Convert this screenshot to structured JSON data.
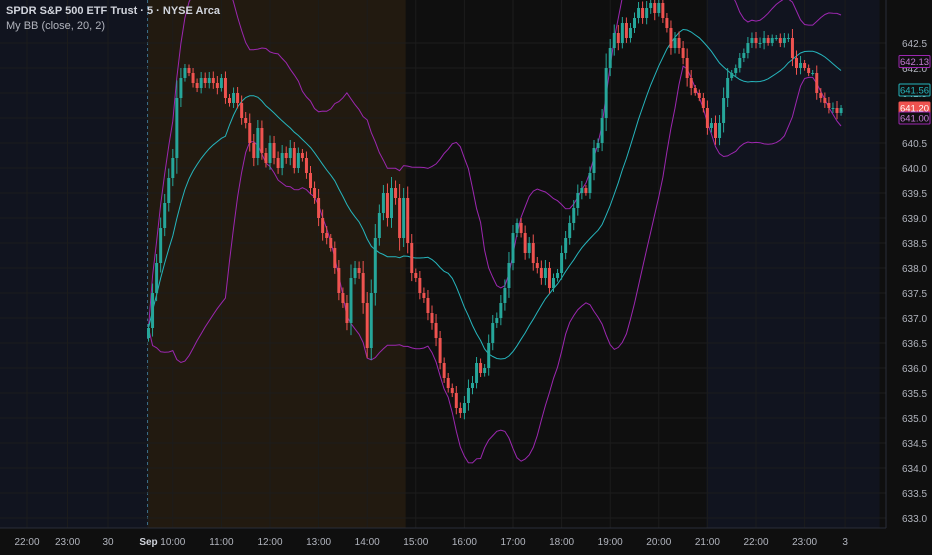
{
  "legend": {
    "symbol_title": "SPDR S&P 500 ETF Trust · 5 · NYSE Arca",
    "indicator": "My BB (close, 20, 2)"
  },
  "colors": {
    "background": "#0f0f0f",
    "up": "#26a69a",
    "down": "#ef5350",
    "basis": "#26b5bd",
    "bands": "#9c27b0",
    "premarket_bg": "#221a10",
    "afterhours_bg": "#11141f",
    "grid": "#1c1c1c",
    "axis_text": "#b2b5be"
  },
  "chart_data": {
    "type": "candlestick",
    "y_ticks": [
      "642.5",
      "642.0",
      "641.5",
      "641.0",
      "640.5",
      "640.0",
      "639.5",
      "639.0",
      "638.5",
      "638.0",
      "637.5",
      "637.0",
      "636.5",
      "636.0",
      "635.5",
      "635.0",
      "634.5",
      "634.0",
      "633.5",
      "633.0"
    ],
    "ylim": [
      632.8,
      643.2
    ],
    "x_ticks": [
      {
        "label": "22:00",
        "bar": -30
      },
      {
        "label": "23:00",
        "bar": -20
      },
      {
        "label": "30",
        "bar": -10
      },
      {
        "label": "Sep",
        "bar": 0,
        "bold": true
      },
      {
        "label": "10:00",
        "bar": 6
      },
      {
        "label": "11:00",
        "bar": 18
      },
      {
        "label": "12:00",
        "bar": 30
      },
      {
        "label": "13:00",
        "bar": 42
      },
      {
        "label": "14:00",
        "bar": 54
      },
      {
        "label": "15:00",
        "bar": 66
      },
      {
        "label": "16:00",
        "bar": 78
      },
      {
        "label": "17:00",
        "bar": 90
      },
      {
        "label": "18:00",
        "bar": 102
      },
      {
        "label": "19:00",
        "bar": 114
      },
      {
        "label": "20:00",
        "bar": 126
      },
      {
        "label": "21:00",
        "bar": 138
      },
      {
        "label": "22:00",
        "bar": 150
      },
      {
        "label": "23:00",
        "bar": 162
      },
      {
        "label": "3",
        "bar": 172
      }
    ],
    "sessions": [
      {
        "name": "premarket",
        "from": 0,
        "to": 63
      },
      {
        "name": "afterhours",
        "from": 138,
        "to": 180
      }
    ],
    "closes": [
      636.8,
      637.5,
      638.1,
      638.8,
      639.3,
      639.8,
      640.2,
      641.4,
      641.8,
      642.0,
      641.9,
      641.7,
      641.6,
      641.8,
      641.7,
      641.8,
      641.7,
      641.6,
      641.8,
      641.4,
      641.3,
      641.5,
      641.3,
      641.0,
      640.9,
      640.5,
      640.2,
      640.8,
      640.3,
      640.1,
      640.5,
      640.2,
      640.0,
      640.3,
      640.2,
      640.4,
      640.0,
      640.3,
      640.2,
      639.9,
      639.6,
      639.4,
      639.0,
      638.7,
      638.6,
      638.4,
      638.0,
      637.5,
      637.3,
      636.9,
      637.8,
      638.0,
      637.9,
      637.3,
      636.4,
      637.5,
      638.6,
      639.1,
      639.5,
      639.0,
      639.6,
      639.4,
      638.6,
      639.4,
      638.5,
      637.9,
      637.8,
      637.5,
      637.4,
      637.1,
      636.9,
      636.6,
      636.1,
      635.8,
      635.6,
      635.5,
      635.2,
      635.1,
      635.3,
      635.6,
      635.7,
      636.1,
      635.9,
      636.0,
      636.5,
      636.9,
      637.0,
      637.3,
      637.6,
      638.1,
      638.7,
      638.9,
      638.7,
      638.3,
      638.5,
      638.1,
      638.0,
      637.8,
      638.0,
      637.6,
      637.8,
      637.9,
      638.3,
      638.6,
      638.9,
      639.2,
      639.5,
      639.6,
      639.5,
      639.9,
      640.4,
      640.5,
      641.0,
      642.0,
      642.4,
      642.7,
      642.5,
      642.9,
      642.6,
      642.8,
      643.0,
      643.2,
      643.0,
      643.2,
      643.3,
      643.1,
      643.3,
      643.0,
      642.8,
      642.4,
      642.6,
      642.4,
      642.2,
      641.8,
      641.6,
      641.5,
      641.4,
      641.2,
      640.8,
      640.9,
      640.6,
      640.9,
      641.4,
      641.8,
      641.9,
      642.0,
      642.2,
      642.3,
      642.5,
      642.6,
      642.5,
      642.5,
      642.6,
      642.5,
      642.6,
      642.6,
      642.5,
      642.6,
      642.6,
      642.2,
      642.0,
      642.1,
      642.0,
      641.9,
      641.9,
      641.5,
      641.4,
      641.3,
      641.2,
      641.2,
      641.1,
      641.2
    ],
    "price_labels": [
      {
        "value": 642.13,
        "text": "642.13",
        "style": "outline-purple"
      },
      {
        "value": 641.56,
        "text": "641.56",
        "style": "outline-teal"
      },
      {
        "value": 641.2,
        "text": "641.20",
        "style": "red"
      },
      {
        "value": 641.0,
        "text": "641.00",
        "style": "outline-purple"
      }
    ]
  }
}
